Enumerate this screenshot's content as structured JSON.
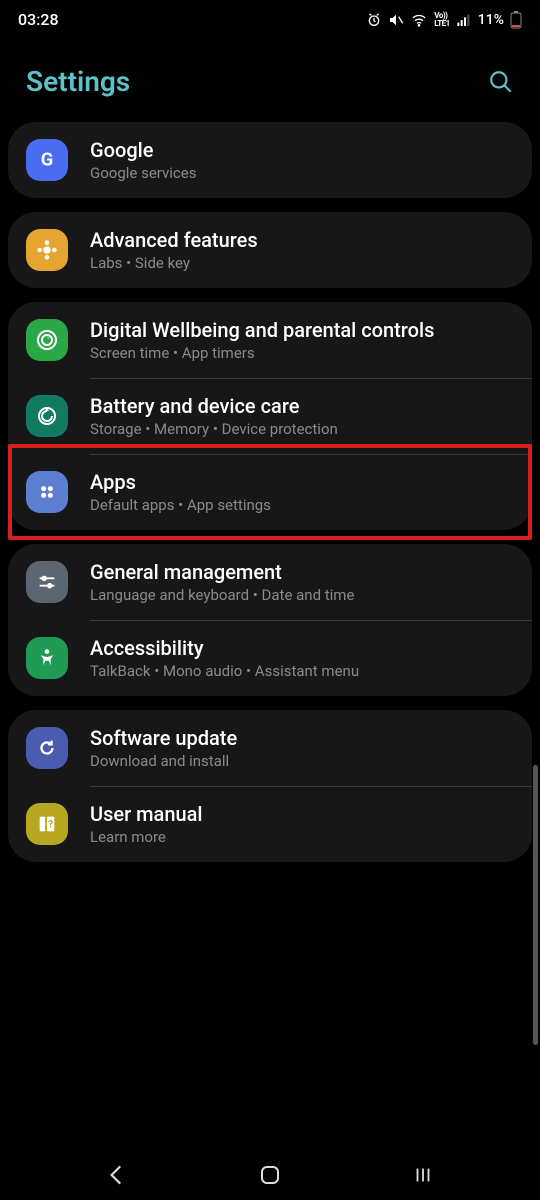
{
  "status": {
    "time": "03:28",
    "battery_text": "11%"
  },
  "header": {
    "title": "Settings"
  },
  "groups": [
    {
      "items": [
        {
          "id": "google",
          "title": "Google",
          "sub": "Google services",
          "icon": "google",
          "color": "#4a6cf0"
        }
      ]
    },
    {
      "items": [
        {
          "id": "advanced",
          "title": "Advanced features",
          "sub": "Labs  •  Side key",
          "icon": "gear-flower",
          "color": "#e6a531"
        }
      ]
    },
    {
      "items": [
        {
          "id": "wellbeing",
          "title": "Digital Wellbeing and parental controls",
          "sub": "Screen time  •  App timers",
          "icon": "wellbeing",
          "color": "#2aa845"
        },
        {
          "id": "battery",
          "title": "Battery and device care",
          "sub": "Storage  •  Memory  •  Device protection",
          "icon": "battery-care",
          "color": "#117a63"
        },
        {
          "id": "apps",
          "title": "Apps",
          "sub": "Default apps  •  App settings",
          "icon": "apps",
          "color": "#5d7fd1",
          "highlighted": true
        }
      ]
    },
    {
      "items": [
        {
          "id": "general",
          "title": "General management",
          "sub": "Language and keyboard  •  Date and time",
          "icon": "sliders",
          "color": "#5b6672"
        },
        {
          "id": "accessibility",
          "title": "Accessibility",
          "sub": "TalkBack  •  Mono audio  •  Assistant menu",
          "icon": "accessibility",
          "color": "#1f9b55"
        }
      ]
    },
    {
      "items": [
        {
          "id": "software",
          "title": "Software update",
          "sub": "Download and install",
          "icon": "update",
          "color": "#4a5bb0"
        },
        {
          "id": "manual",
          "title": "User manual",
          "sub": "Learn more",
          "icon": "manual",
          "color": "#b7a723"
        }
      ]
    }
  ]
}
